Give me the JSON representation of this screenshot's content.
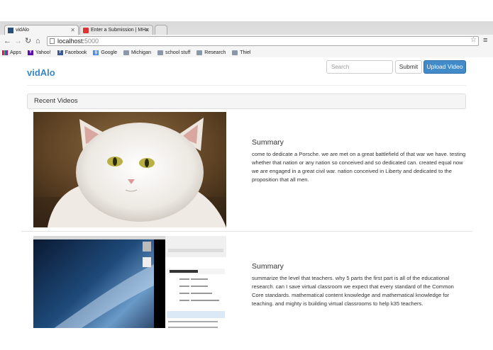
{
  "browser": {
    "tabs": [
      {
        "title": "vidAlo",
        "active": true
      },
      {
        "title": "Enter a Submission | MHa",
        "active": false
      }
    ],
    "url_host": "localhost:",
    "url_port": "5000",
    "bookmarks": [
      {
        "label": "Apps",
        "icon": "apps-icon"
      },
      {
        "label": "Yahoo!",
        "icon": "yahoo-icon"
      },
      {
        "label": "Facebook",
        "icon": "facebook-icon"
      },
      {
        "label": "Google",
        "icon": "google-icon"
      },
      {
        "label": "Michigan",
        "icon": "folder-icon"
      },
      {
        "label": "school stuff",
        "icon": "folder-icon"
      },
      {
        "label": "Research",
        "icon": "folder-icon"
      },
      {
        "label": "Thiel",
        "icon": "folder-icon"
      }
    ]
  },
  "navbar": {
    "brand": "vidAlo",
    "search_placeholder": "Search",
    "search_button": "Submit",
    "upload_button": "Upload Video",
    "accent_color": "#428bca"
  },
  "panel": {
    "title": "Recent Videos"
  },
  "videos": [
    {
      "summary_title": "Summary",
      "summary_text": "come to dedicate a Porsche. we are met on a great battlefield of that war we have. testing whether that nation or any nation so conceived and so dedicated can. created equal now we are engaged in a great civil war. nation conceived in Liberty and dedicated to the proposition that all men."
    },
    {
      "summary_title": "Summary",
      "summary_text": "summarize the level that teachers. why 5 parts the first part is all of the educational research. can I save virtual classroom we expect that every standard of the Common Core standards. mathematical content knowledge and mathematical knowledge for teaching. and mighty is building virtual classrooms to help k35 teachers."
    }
  ]
}
